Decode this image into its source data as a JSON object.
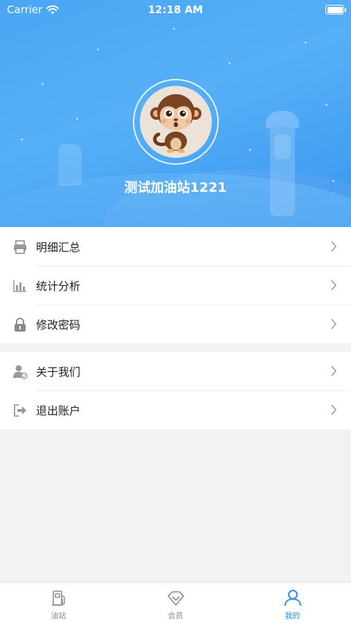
{
  "status_bar": {
    "carrier": "Carrier",
    "time": "12:18 AM"
  },
  "profile": {
    "station_name": "测试加油站1221",
    "avatar_icon": "monkey-avatar"
  },
  "menu_groups": [
    {
      "items": [
        {
          "label": "明细汇总",
          "icon": "printer-icon"
        },
        {
          "label": "统计分析",
          "icon": "bar-chart-icon"
        },
        {
          "label": "修改密码",
          "icon": "lock-icon"
        }
      ]
    },
    {
      "items": [
        {
          "label": "关于我们",
          "icon": "user-info-icon"
        },
        {
          "label": "退出账户",
          "icon": "logout-icon"
        }
      ]
    }
  ],
  "tabbar": {
    "tabs": [
      {
        "label": "油站",
        "icon": "fuel-pump-icon",
        "active": false
      },
      {
        "label": "会员",
        "icon": "diamond-icon",
        "active": false
      },
      {
        "label": "我的",
        "icon": "person-icon",
        "active": true
      }
    ]
  },
  "colors": {
    "accent": "#2a8cf0",
    "header_blue": "#4aa6f3",
    "icon_gray": "#8a8a8a"
  }
}
